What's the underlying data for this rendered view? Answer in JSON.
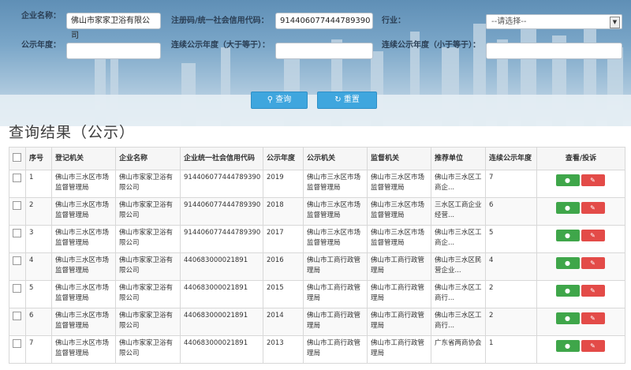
{
  "search": {
    "company_name_label": "企业名称：",
    "company_name_value": "佛山市家家卫浴有限公司",
    "reg_code_label": "注册码/统一社会信用代码：",
    "reg_code_value": "914406077444789390",
    "industry_label": "行业：",
    "industry_selected": "--请选择--",
    "year_label": "公示年度：",
    "year_value": "",
    "consec_gt_label": "连续公示年度（大于等于）：",
    "consec_gt_value": "",
    "consec_lt_label": "连续公示年度（小于等于）：",
    "consec_lt_value": "",
    "query_button": "查询",
    "reset_button": "重置"
  },
  "results": {
    "title": "查询结果（公示）",
    "headers": [
      "序号",
      "登记机关",
      "企业名称",
      "企业统一社会信用代码",
      "公示年度",
      "公示机关",
      "监督机关",
      "推荐单位",
      "连续公示年度",
      "查看/投诉"
    ],
    "rows": [
      {
        "no": "1",
        "reg_org": "佛山市三水区市场监督管理局",
        "company": "佛山市家家卫浴有限公司",
        "code": "914406077444789390",
        "year": "2019",
        "pub_org": "佛山市三水区市场监督管理局",
        "sup_org": "佛山市三水区市场监督管理局",
        "recommender": "佛山市三水区工商企...",
        "consec": "7"
      },
      {
        "no": "2",
        "reg_org": "佛山市三水区市场监督管理局",
        "company": "佛山市家家卫浴有限公司",
        "code": "914406077444789390",
        "year": "2018",
        "pub_org": "佛山市三水区市场监督管理局",
        "sup_org": "佛山市三水区市场监督管理局",
        "recommender": "三水区工商企业经营...",
        "consec": "6"
      },
      {
        "no": "3",
        "reg_org": "佛山市三水区市场监督管理局",
        "company": "佛山市家家卫浴有限公司",
        "code": "914406077444789390",
        "year": "2017",
        "pub_org": "佛山市三水区市场监督管理局",
        "sup_org": "佛山市三水区市场监督管理局",
        "recommender": "佛山市三水区工商企...",
        "consec": "5"
      },
      {
        "no": "4",
        "reg_org": "佛山市三水区市场监督管理局",
        "company": "佛山市家家卫浴有限公司",
        "code": "440683000021891",
        "year": "2016",
        "pub_org": "佛山市工商行政管理局",
        "sup_org": "佛山市工商行政管理局",
        "recommender": "佛山市三水区民营企业...",
        "consec": "4"
      },
      {
        "no": "5",
        "reg_org": "佛山市三水区市场监督管理局",
        "company": "佛山市家家卫浴有限公司",
        "code": "440683000021891",
        "year": "2015",
        "pub_org": "佛山市工商行政管理局",
        "sup_org": "佛山市工商行政管理局",
        "recommender": "佛山市三水区工商行...",
        "consec": "2"
      },
      {
        "no": "6",
        "reg_org": "佛山市三水区市场监督管理局",
        "company": "佛山市家家卫浴有限公司",
        "code": "440683000021891",
        "year": "2014",
        "pub_org": "佛山市工商行政管理局",
        "sup_org": "佛山市工商行政管理局",
        "recommender": "佛山市三水区工商行...",
        "consec": "2"
      },
      {
        "no": "7",
        "reg_org": "佛山市三水区市场监督管理局",
        "company": "佛山市家家卫浴有限公司",
        "code": "440683000021891",
        "year": "2013",
        "pub_org": "佛山市工商行政管理局",
        "sup_org": "佛山市工商行政管理局",
        "recommender": "广东省两商协会",
        "consec": "1"
      }
    ]
  },
  "icons": {
    "view": "user-profile-icon",
    "complaint": "edit-icon",
    "query": "search-icon",
    "reset": "refresh-icon"
  },
  "colors": {
    "primary_button": "#3fa6de",
    "view_button": "#3fa64a",
    "complaint_button": "#e34b48"
  }
}
